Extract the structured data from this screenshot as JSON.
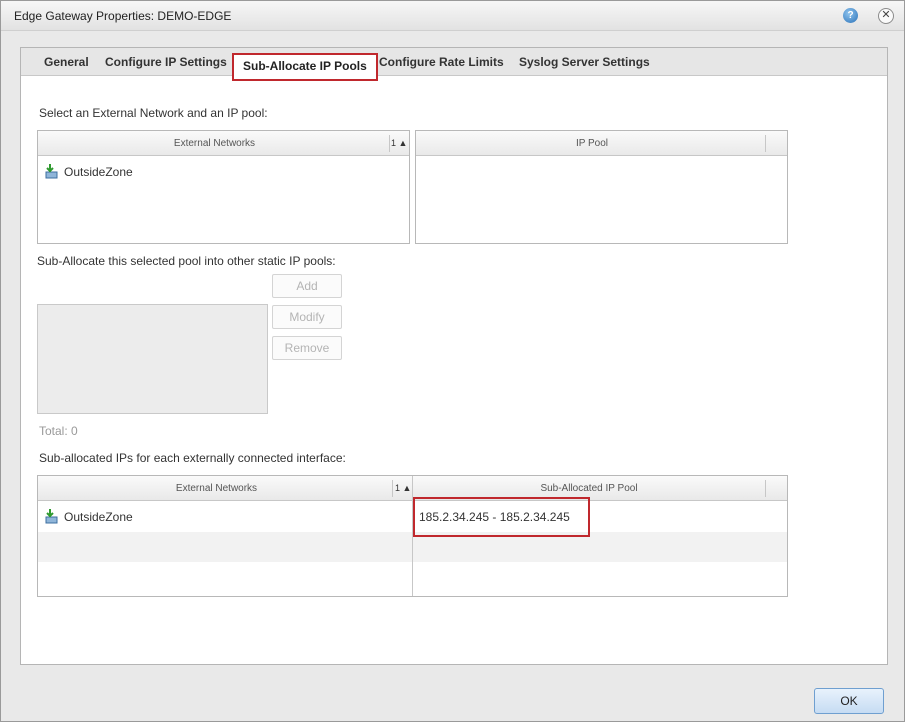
{
  "dialog": {
    "title": "Edge Gateway Properties: DEMO-EDGE",
    "help_icon": "help-icon",
    "close_icon": "close-icon"
  },
  "tabs": [
    {
      "label": "General",
      "active": false
    },
    {
      "label": "Configure IP Settings",
      "active": false
    },
    {
      "label": "Sub-Allocate IP Pools",
      "active": true
    },
    {
      "label": "Configure Rate Limits",
      "active": false
    },
    {
      "label": "Syslog Server Settings",
      "active": false
    }
  ],
  "select_section": {
    "prompt": "Select an External Network and an IP pool:",
    "networks_grid": {
      "header": "External Networks",
      "sort_indicator": "1 ▲",
      "rows": [
        {
          "name": "OutsideZone",
          "icon": "network-icon"
        }
      ]
    },
    "ip_pool_grid": {
      "header": "IP Pool",
      "rows": []
    }
  },
  "suballocate_section": {
    "prompt": "Sub-Allocate this selected pool into other static IP pools:",
    "buttons": {
      "add": "Add",
      "modify": "Modify",
      "remove": "Remove"
    },
    "total": "Total: 0"
  },
  "suballocated_section": {
    "prompt": "Sub-allocated IPs for each externally connected interface:",
    "grid": {
      "col_networks": "External Networks",
      "col_pool": "Sub-Allocated IP Pool",
      "sort_indicator": "1 ▲",
      "rows": [
        {
          "network": "OutsideZone",
          "pool": "185.2.34.245 - 185.2.34.245",
          "icon": "network-icon"
        }
      ]
    }
  },
  "footer": {
    "ok_label": "OK"
  },
  "colors": {
    "highlight": "#c0282d",
    "accent": "#2b72b8"
  }
}
